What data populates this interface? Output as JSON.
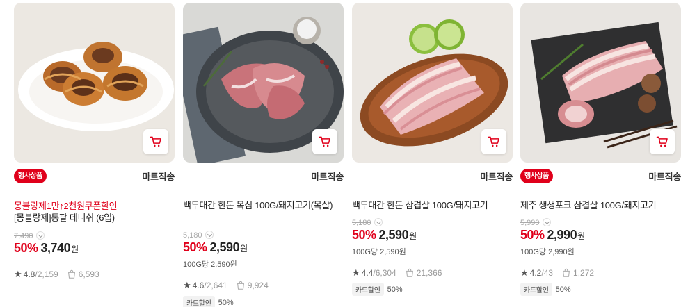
{
  "products": [
    {
      "event_badge": "행사상품",
      "shipping": "마트직송",
      "promo": "몽블랑제1만↑2천원쿠폰할인",
      "title": "[몽블랑제]통팥 데니쉬 (6입)",
      "original_price": "7,490",
      "discount_rate": "50%",
      "price": "3,740",
      "currency": "원",
      "unit_price": "",
      "rating": "4.8",
      "reviews": "2,159",
      "purchases": "6,593",
      "card_discount_label": "",
      "card_discount_rate": "",
      "image_icon": "pastry-image"
    },
    {
      "event_badge": "",
      "shipping": "마트직송",
      "promo": "",
      "title": "백두대간 한돈 목심 100G/돼지고기(목살)",
      "original_price": "5,180",
      "discount_rate": "50%",
      "price": "2,590",
      "currency": "원",
      "unit_price": "100G당 2,590원",
      "rating": "4.6",
      "reviews": "2,641",
      "purchases": "9,924",
      "card_discount_label": "카드할인",
      "card_discount_rate": "50%",
      "image_icon": "pork-neck-image"
    },
    {
      "event_badge": "",
      "shipping": "마트직송",
      "promo": "",
      "title": "백두대간 한돈 삼겹살 100G/돼지고기",
      "original_price": "5,180",
      "discount_rate": "50%",
      "price": "2,590",
      "currency": "원",
      "unit_price": "100G당 2,590원",
      "rating": "4.4",
      "reviews": "6,304",
      "purchases": "21,366",
      "card_discount_label": "카드할인",
      "card_discount_rate": "50%",
      "image_icon": "pork-belly-image"
    },
    {
      "event_badge": "행사상품",
      "shipping": "마트직송",
      "promo": "",
      "title": "제주 생생포크 삼겹살 100G/돼지고기",
      "original_price": "5,990",
      "discount_rate": "50%",
      "price": "2,990",
      "currency": "원",
      "unit_price": "100G당 2,990원",
      "rating": "4.2",
      "reviews": "43",
      "purchases": "1,272",
      "card_discount_label": "카드할인",
      "card_discount_rate": "50%",
      "image_icon": "jeju-pork-belly-image"
    }
  ],
  "colors": {
    "accent": "#e0001b",
    "badge_bg": "#e0001b",
    "chip_bg": "#f2f2f2"
  },
  "icons": {
    "cart": "cart-icon",
    "star": "star-icon",
    "purchase": "shopping-bag-icon"
  }
}
